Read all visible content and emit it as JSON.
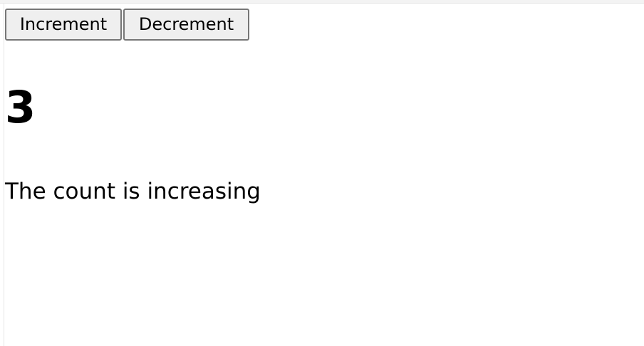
{
  "controls": {
    "increment_label": "Increment",
    "decrement_label": "Decrement"
  },
  "counter": {
    "value": "3",
    "status_text": "The count is increasing"
  }
}
